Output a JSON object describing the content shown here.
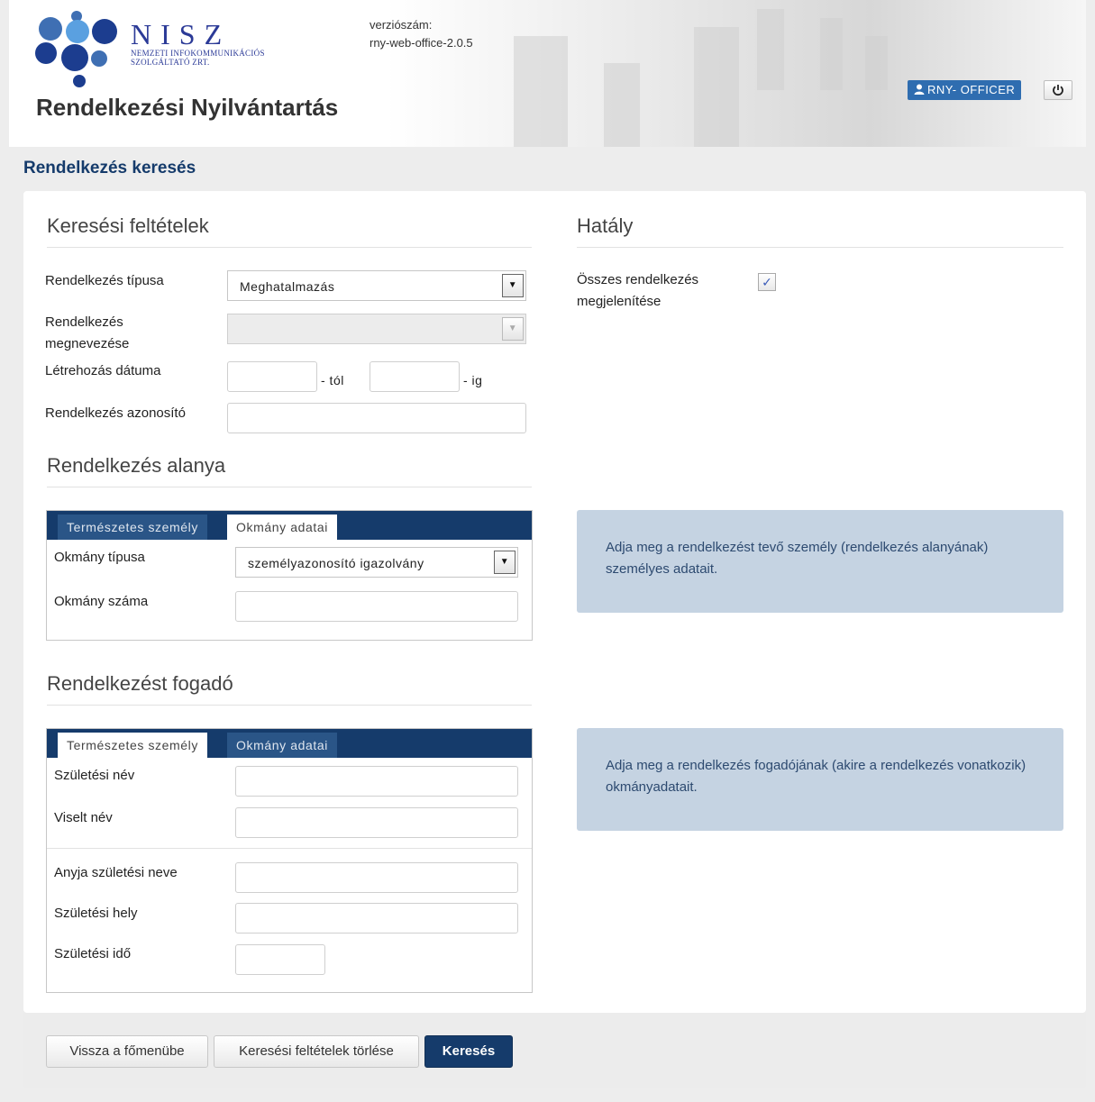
{
  "header": {
    "logo_name": "NISZ",
    "logo_sub1": "NEMZETI INFOKOMMUNIKÁCIÓS",
    "logo_sub2": "SZOLGÁLTATÓ ZRT.",
    "app_title": "Rendelkezési Nyilvántartás",
    "version_label": "verziószám:",
    "version_value": "rny-web-office-2.0.5",
    "user_label": "RNY- OFFICER",
    "user_icon": "user-icon",
    "power_icon": "power-icon"
  },
  "page_title": "Rendelkezés keresés",
  "criteria": {
    "title": "Keresési feltételek",
    "type_label": "Rendelkezés típusa",
    "type_value": "Meghatalmazás",
    "name_label_1": "Rendelkezés",
    "name_label_2": "megnevezése",
    "name_value": "",
    "created_label": "Létrehozás dátuma",
    "from_value": "",
    "from_suffix": "- tól",
    "to_value": "",
    "to_suffix": "- ig",
    "id_label": "Rendelkezés azonosító",
    "id_value": ""
  },
  "effect": {
    "title": "Hatály",
    "all_label_1": "Összes rendelkezés",
    "all_label_2": "megjelenítése",
    "all_checked": true
  },
  "subject": {
    "title": "Rendelkezés alanya",
    "tabs": [
      "Természetes személy",
      "Okmány adatai"
    ],
    "active_tab": 1,
    "doc_type_label": "Okmány típusa",
    "doc_type_value": "személyazonosító igazolvány",
    "doc_number_label": "Okmány száma",
    "doc_number_value": "",
    "info": "Adja meg a rendelkezést tevő személy (rendelkezés alanyának) személyes adatait."
  },
  "receiver": {
    "title": "Rendelkezést fogadó",
    "tabs": [
      "Természetes személy",
      "Okmány adatai"
    ],
    "active_tab": 0,
    "birth_name_label": "Születési név",
    "current_name_label": "Viselt név",
    "mother_name_label": "Anyja születési neve",
    "birth_place_label": "Születési hely",
    "birth_date_label": "Születési idő",
    "info": "Adja meg a rendelkezés fogadójának (akire a rendelkezés vonatkozik) okmányadatait."
  },
  "footer": {
    "back_label": "Vissza a főmenübe",
    "clear_label": "Keresési feltételek törlése",
    "search_label": "Keresés"
  },
  "colors": {
    "primary": "#153b6b",
    "info_bg": "#c5d3e2",
    "badge": "#2f6db0"
  }
}
